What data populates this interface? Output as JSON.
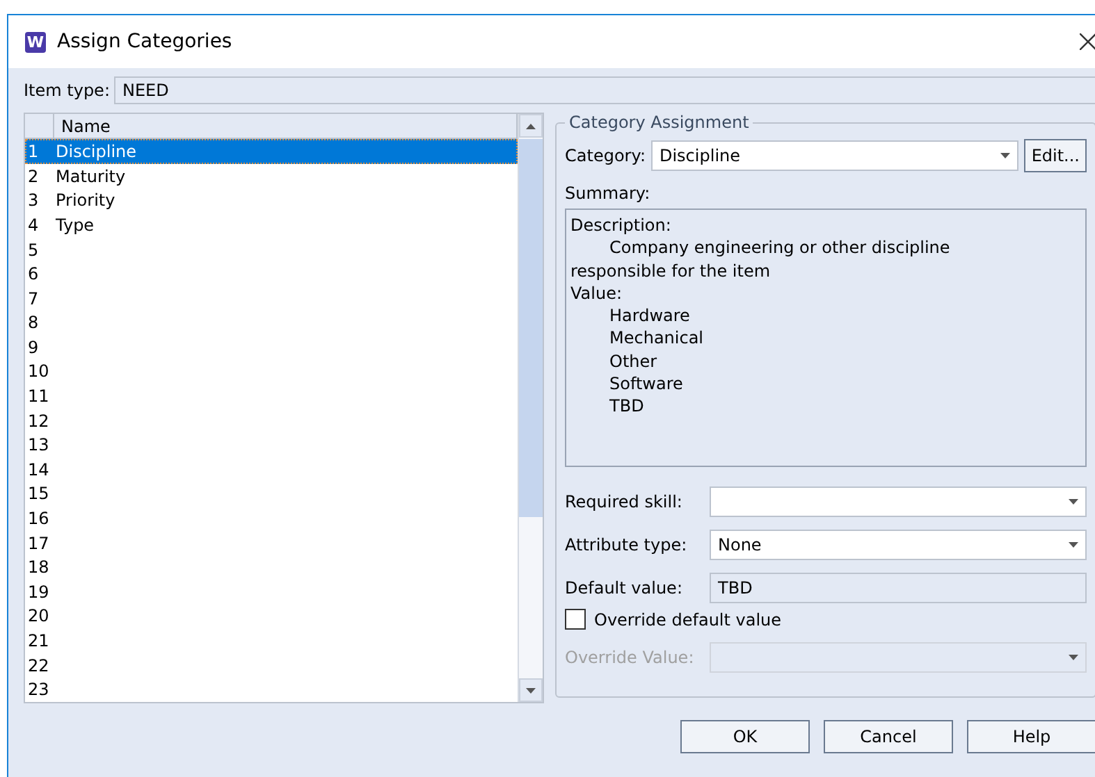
{
  "window": {
    "title": "Assign Categories",
    "app_icon": "W"
  },
  "item_type": {
    "label": "Item type:",
    "value": "NEED"
  },
  "list": {
    "columns": [
      "Name"
    ],
    "rows": [
      {
        "number": "1",
        "name": "Discipline",
        "selected": true
      },
      {
        "number": "2",
        "name": "Maturity",
        "selected": false
      },
      {
        "number": "3",
        "name": "Priority",
        "selected": false
      },
      {
        "number": "4",
        "name": "Type",
        "selected": false
      },
      {
        "number": "5",
        "selected": false
      },
      {
        "number": "6",
        "selected": false
      },
      {
        "number": "7",
        "selected": false
      },
      {
        "number": "8",
        "selected": false
      },
      {
        "number": "9",
        "selected": false
      },
      {
        "number": "10",
        "selected": false
      },
      {
        "number": "11",
        "selected": false
      },
      {
        "number": "12",
        "selected": false
      },
      {
        "number": "13",
        "selected": false
      },
      {
        "number": "14",
        "selected": false
      },
      {
        "number": "15",
        "selected": false
      },
      {
        "number": "16",
        "selected": false
      },
      {
        "number": "17",
        "selected": false
      },
      {
        "number": "18",
        "selected": false
      },
      {
        "number": "19",
        "selected": false
      },
      {
        "number": "20",
        "selected": false
      },
      {
        "number": "21",
        "selected": false
      },
      {
        "number": "22",
        "selected": false
      },
      {
        "number": "23",
        "selected": false
      }
    ]
  },
  "category_assignment": {
    "legend": "Category Assignment",
    "category": {
      "label": "Category:",
      "value": "Discipline"
    },
    "edit_button": "Edit...",
    "summary_label": "Summary:",
    "summary": [
      {
        "text": "Description:",
        "indented": false
      },
      {
        "text": "Company engineering or other discipline",
        "indented": true
      },
      {
        "text": "responsible for the item",
        "indented": false
      },
      {
        "text": "Value:",
        "indented": false
      },
      {
        "text": "Hardware",
        "indented": true
      },
      {
        "text": "Mechanical",
        "indented": true
      },
      {
        "text": "Other",
        "indented": true
      },
      {
        "text": "Software",
        "indented": true
      },
      {
        "text": "TBD",
        "indented": true
      }
    ],
    "required_skill": {
      "label": "Required skill:"
    },
    "attribute_type": {
      "label": "Attribute type:",
      "value": "None"
    },
    "default_value": {
      "label": "Default value:",
      "value": "TBD"
    },
    "override_checkbox": {
      "label": "Override default value",
      "checked": false
    },
    "override_value": {
      "label": "Override Value:",
      "disabled": true
    }
  },
  "buttons": [
    "OK",
    "Cancel",
    "Help"
  ]
}
